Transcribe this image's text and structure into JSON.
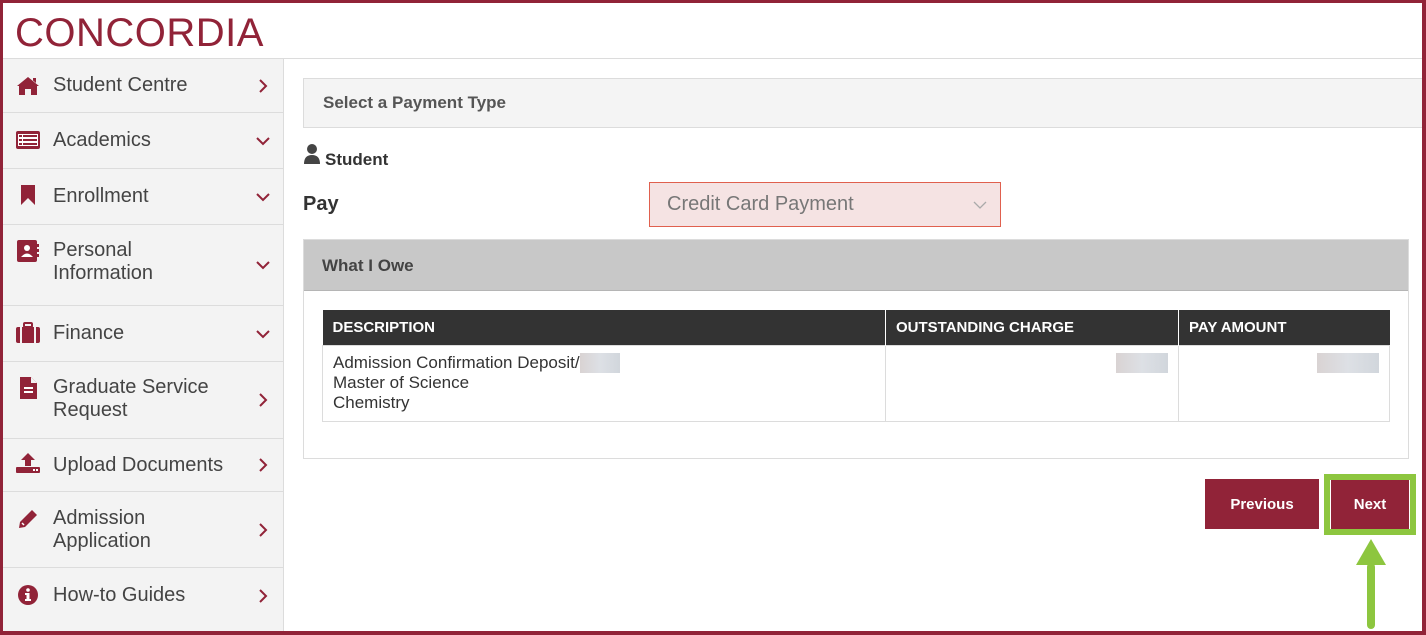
{
  "header": {
    "logo": "CONCORDIA"
  },
  "sidebar": {
    "items": [
      {
        "label": "Student Centre",
        "icon": "home-icon",
        "chevron": "right"
      },
      {
        "label": "Academics",
        "icon": "list-card-icon",
        "chevron": "down"
      },
      {
        "label": "Enrollment",
        "icon": "bookmark-icon",
        "chevron": "down"
      },
      {
        "label": "Personal Information",
        "icon": "address-book-icon",
        "chevron": "down"
      },
      {
        "label": "Finance",
        "icon": "briefcase-icon",
        "chevron": "down"
      },
      {
        "label": "Graduate Service Request",
        "icon": "document-icon",
        "chevron": "right"
      },
      {
        "label": "Upload Documents",
        "icon": "upload-icon",
        "chevron": "right"
      },
      {
        "label": "Admission Application",
        "icon": "pencil-icon",
        "chevron": "right"
      },
      {
        "label": "How-to Guides",
        "icon": "info-icon",
        "chevron": "right"
      }
    ]
  },
  "main": {
    "section_title": "Select a Payment Type",
    "student_label": "Student",
    "pay_label": "Pay",
    "pay_select": {
      "value": "Credit Card Payment"
    },
    "owe": {
      "title": "What I Owe",
      "columns": [
        "DESCRIPTION",
        "OUTSTANDING CHARGE",
        "PAY AMOUNT"
      ],
      "rows": [
        {
          "description_lines": [
            "Admission Confirmation Deposit/",
            "Master of Science",
            "Chemistry"
          ],
          "outstanding_charge": "",
          "pay_amount": ""
        }
      ]
    },
    "buttons": {
      "previous": "Previous",
      "next": "Next"
    }
  },
  "colors": {
    "brand": "#912338",
    "highlight": "#8dc63f",
    "select_bg": "#f5e3e3",
    "select_border": "#e0604e"
  }
}
